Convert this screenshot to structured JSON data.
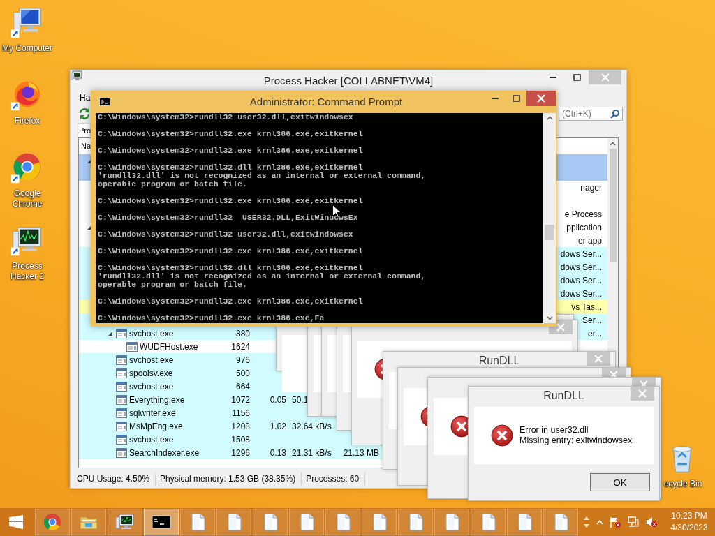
{
  "desktop_icons": [
    {
      "kind": "computer",
      "label": "My Computer"
    },
    {
      "kind": "fox",
      "label": "Firefox"
    },
    {
      "kind": "chrome",
      "label": "Google Chrome"
    },
    {
      "kind": "monitor",
      "label": "Process Hacker 2"
    },
    {
      "kind": "bin",
      "label": "ecycle Bin"
    }
  ],
  "process_hacker": {
    "title": "Process Hacker [COLLABNET\\VM4]",
    "menu": [
      "Ha"
    ],
    "search": {
      "placeholder": "(Ctrl+K)"
    },
    "tabs": [
      {
        "label": "Pro",
        "selected": true
      }
    ],
    "columns": [
      "Na"
    ],
    "rows": [
      {
        "selected": true,
        "expanded": true,
        "children": [
          {
            "selected": true,
            "children": [
              {
                "selected": false,
                "color": "#ffffff",
                "description": "nager"
              }
            ]
          }
        ]
      },
      {
        "selected": false,
        "color": "#ffffff"
      },
      {
        "selected": false,
        "color": "#ffffff",
        "description": "e Process"
      },
      {
        "selected": false,
        "color": "#ffffff",
        "expanded": true,
        "description": "pplication",
        "children": [
          {
            "selected": false,
            "color": "#ffffff",
            "description": "er app",
            "children": [
              {
                "selected": false,
                "color": "#d0fcff",
                "description": "dows Ser..."
              },
              {
                "selected": false,
                "color": "#d0fcff",
                "description": "dows Ser..."
              },
              {
                "selected": false,
                "color": "#d0fcff",
                "description": "dows Ser..."
              },
              {
                "selected": false,
                "color": "#d0fcff",
                "description": "dows Ser..."
              },
              {
                "selected": false,
                "color": "#ffffaa",
                "description": "vs Tas..."
              },
              {
                "selected": false,
                "color": "#d0fcff",
                "description": "Ser..."
              },
              {
                "selected": false,
                "color": "#d0fcff",
                "expanded": true,
                "name": "svchost.exe",
                "pid": "880",
                "description": "er...",
                "children": [
                  {
                    "selected": false,
                    "color": "#ffffff",
                    "name": "WUDFHost.exe",
                    "pid": "1624"
                  }
                ]
              },
              {
                "selected": false,
                "color": "#d0fcff",
                "name": "svchost.exe",
                "pid": "976"
              },
              {
                "selected": false,
                "color": "#d0fcff",
                "name": "spoolsv.exe",
                "pid": "500"
              },
              {
                "selected": false,
                "color": "#d0fcff",
                "name": "svchost.exe",
                "pid": "664"
              },
              {
                "selected": false,
                "color": "#d0fcff",
                "name": "Everything.exe",
                "pid": "1072",
                "cpu": "0.05",
                "io": "50.1"
              },
              {
                "selected": false,
                "color": "#d0fcff",
                "name": "sqlwriter.exe",
                "pid": "1156"
              },
              {
                "selected": false,
                "color": "#d0fcff",
                "name": "MsMpEng.exe",
                "pid": "1208",
                "cpu": "1.02",
                "io": "32.64 kB/s"
              },
              {
                "selected": false,
                "color": "#d0fcff",
                "name": "svchost.exe",
                "pid": "1508"
              },
              {
                "selected": false,
                "color": "#d0fcff",
                "name": "SearchIndexer.exe",
                "pid": "1296",
                "cpu": "0.13",
                "io": "21.31 kB/s",
                "memory": "21.13 MB"
              }
            ]
          }
        ]
      }
    ],
    "status_bar": [
      "CPU Usage: 4.50%",
      "Physical memory: 1.53 GB (38.35%)",
      "Processes: 60"
    ]
  },
  "dialogs": [
    {
      "kind": "back"
    },
    {
      "kind": "back"
    },
    {
      "kind": "back"
    },
    {
      "kind": "back"
    },
    {
      "kind": "back"
    },
    {
      "kind": "back",
      "title": "RunDLL"
    },
    {
      "kind": "back"
    },
    {
      "kind": "back"
    },
    {
      "kind": "front",
      "title": "RunDLL",
      "message": [
        "Error in user32.dll",
        "Missing entry: exitwindowsex"
      ],
      "button": "OK"
    }
  ],
  "command_prompt": {
    "title": "Administrator:  Command Prompt",
    "blocks": [
      [
        "C:\\Windows\\system32>rundll32 user32.dll,exitwindowsex"
      ],
      [
        "C:\\Windows\\system32>rundll32.exe krnl386.exe,exitkernel"
      ],
      [
        "C:\\Windows\\system32>rundll32.exe krnl386.exe,exitkernel"
      ],
      [
        "C:\\Windows\\system32>rundll32.dll krnl386.exe,exitkernel",
        "'rundll32.dll' is not recognized as an internal or external command,",
        "operable program or batch file."
      ],
      [
        "C:\\Windows\\system32>rundll32.exe krnl386.exe,exitkernel"
      ],
      [
        "C:\\Windows\\system32>rundll32  USER32.DLL,ExitWindowsEx"
      ],
      [
        "C:\\Windows\\system32>rundll32 user32.dll,exitwindowsex"
      ],
      [
        "C:\\Windows\\system32>rundll32.exe krnl386.exe,exitkernel"
      ],
      [
        "C:\\Windows\\system32>rundll32.dll krnl386.exe,exitkernel",
        "'rundll32.dll' is not recognized as an internal or external command,",
        "operable program or batch file."
      ],
      [
        "C:\\Windows\\system32>rundll32.exe krnl386.exe,exitkernel"
      ],
      [
        "C:\\Windows\\system32>rundll32.exe krnl386.exe,Fa"
      ]
    ]
  },
  "taskbar": {
    "apps": [
      {
        "kind": "chrome",
        "selected": false
      },
      {
        "kind": "folder",
        "selected": false
      },
      {
        "kind": "monitor",
        "selected": false
      },
      {
        "kind": "console",
        "selected": true
      },
      {
        "kind": "document",
        "selected": false
      },
      {
        "kind": "document",
        "selected": false
      },
      {
        "kind": "document",
        "selected": false
      },
      {
        "kind": "document",
        "selected": false
      },
      {
        "kind": "document",
        "selected": false
      },
      {
        "kind": "document",
        "selected": false
      },
      {
        "kind": "document",
        "selected": false
      },
      {
        "kind": "document",
        "selected": false
      },
      {
        "kind": "document",
        "selected": false
      },
      {
        "kind": "document",
        "selected": false
      },
      {
        "kind": "document",
        "selected": false
      }
    ],
    "clock": {
      "time": "10:23 PM",
      "date": "4/30/2023"
    }
  }
}
